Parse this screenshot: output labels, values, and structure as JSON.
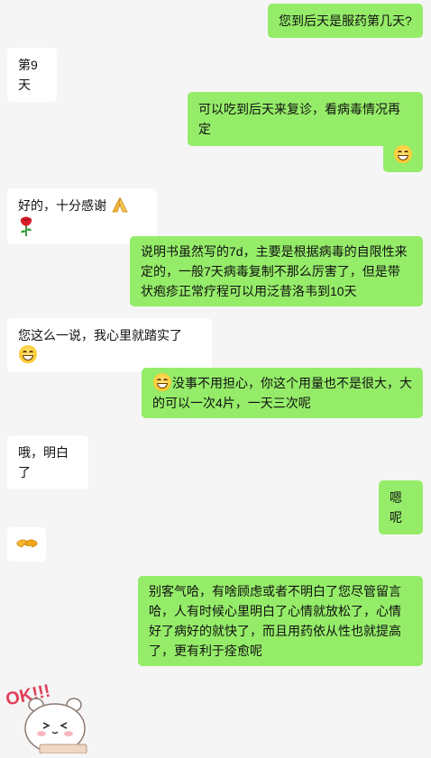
{
  "messages": [
    {
      "side": "out",
      "text": "您到后天是服药第几天?"
    },
    {
      "side": "in",
      "text": "第9天"
    },
    {
      "side": "out",
      "text": "可以吃到后天来复诊，看病毒情况再定"
    },
    {
      "side": "out",
      "emoji": "grin-emoji"
    },
    {
      "side": "in",
      "text": "好的，十分感谢",
      "emojis": [
        "folded-hands-emoji",
        "rose-emoji"
      ]
    },
    {
      "side": "out",
      "text": "说明书虽然写的7d，主要是根据病毒的自限性来定的，一般7天病毒复制不那么厉害了，但是带状疱疹正常疗程可以用泛昔洛韦到10天"
    },
    {
      "side": "in",
      "text": "您这么一说，我心里就踏实了",
      "emojis": [
        "grin-emoji"
      ]
    },
    {
      "side": "out",
      "text": "没事不用担心，你这个用量也不是很大，大的可以一次4片，一天三次呢",
      "emojis": [
        "grin-emoji"
      ]
    },
    {
      "side": "in",
      "text": "哦，明白了"
    },
    {
      "side": "out",
      "text": "嗯呢"
    },
    {
      "side": "in",
      "emoji": "handshake-emoji"
    },
    {
      "side": "out",
      "text": "别客气哈，有啥顾虑或者不明白了您尽管留言哈，人有时候心里明白了心情就放松了，心情好了病好的就快了，而且用药依从性也就提高了，更有利于痊愈呢"
    }
  ],
  "sticker": {
    "text": "OK!!!",
    "icon": "ok-bear-sticker"
  }
}
